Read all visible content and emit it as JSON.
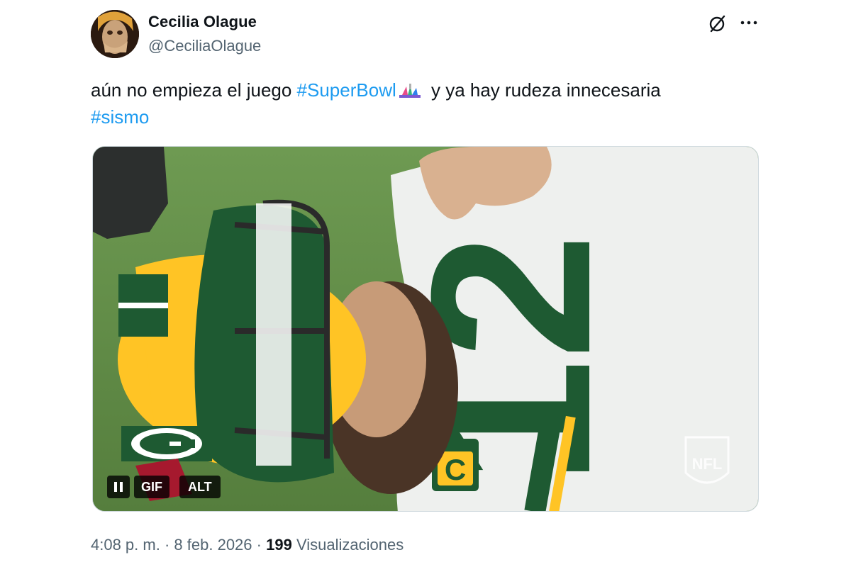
{
  "author": {
    "name": "Cecilia Olague",
    "handle": "@CeciliaOlague"
  },
  "post": {
    "text_part1": "aún no empieza el juego ",
    "hashtag1": "#SuperBowl",
    "text_part2": " y ya hay rudeza innecesaria",
    "hashtag2": "#sismo"
  },
  "media": {
    "type": "gif",
    "gif_label": "GIF",
    "alt_label": "ALT",
    "jersey_number": "12",
    "watermark": "NFL"
  },
  "meta": {
    "time": "4:08 p. m.",
    "separator": "·",
    "date": "8 feb. 2026",
    "views_count": "199",
    "views_label": "Visualizaciones"
  },
  "colors": {
    "link": "#1d9bf0",
    "text": "#0f1419",
    "muted": "#536471"
  },
  "icons": [
    "grok-icon",
    "more-horizontal-icon",
    "pause-icon",
    "superbowl-emoji-icon"
  ]
}
